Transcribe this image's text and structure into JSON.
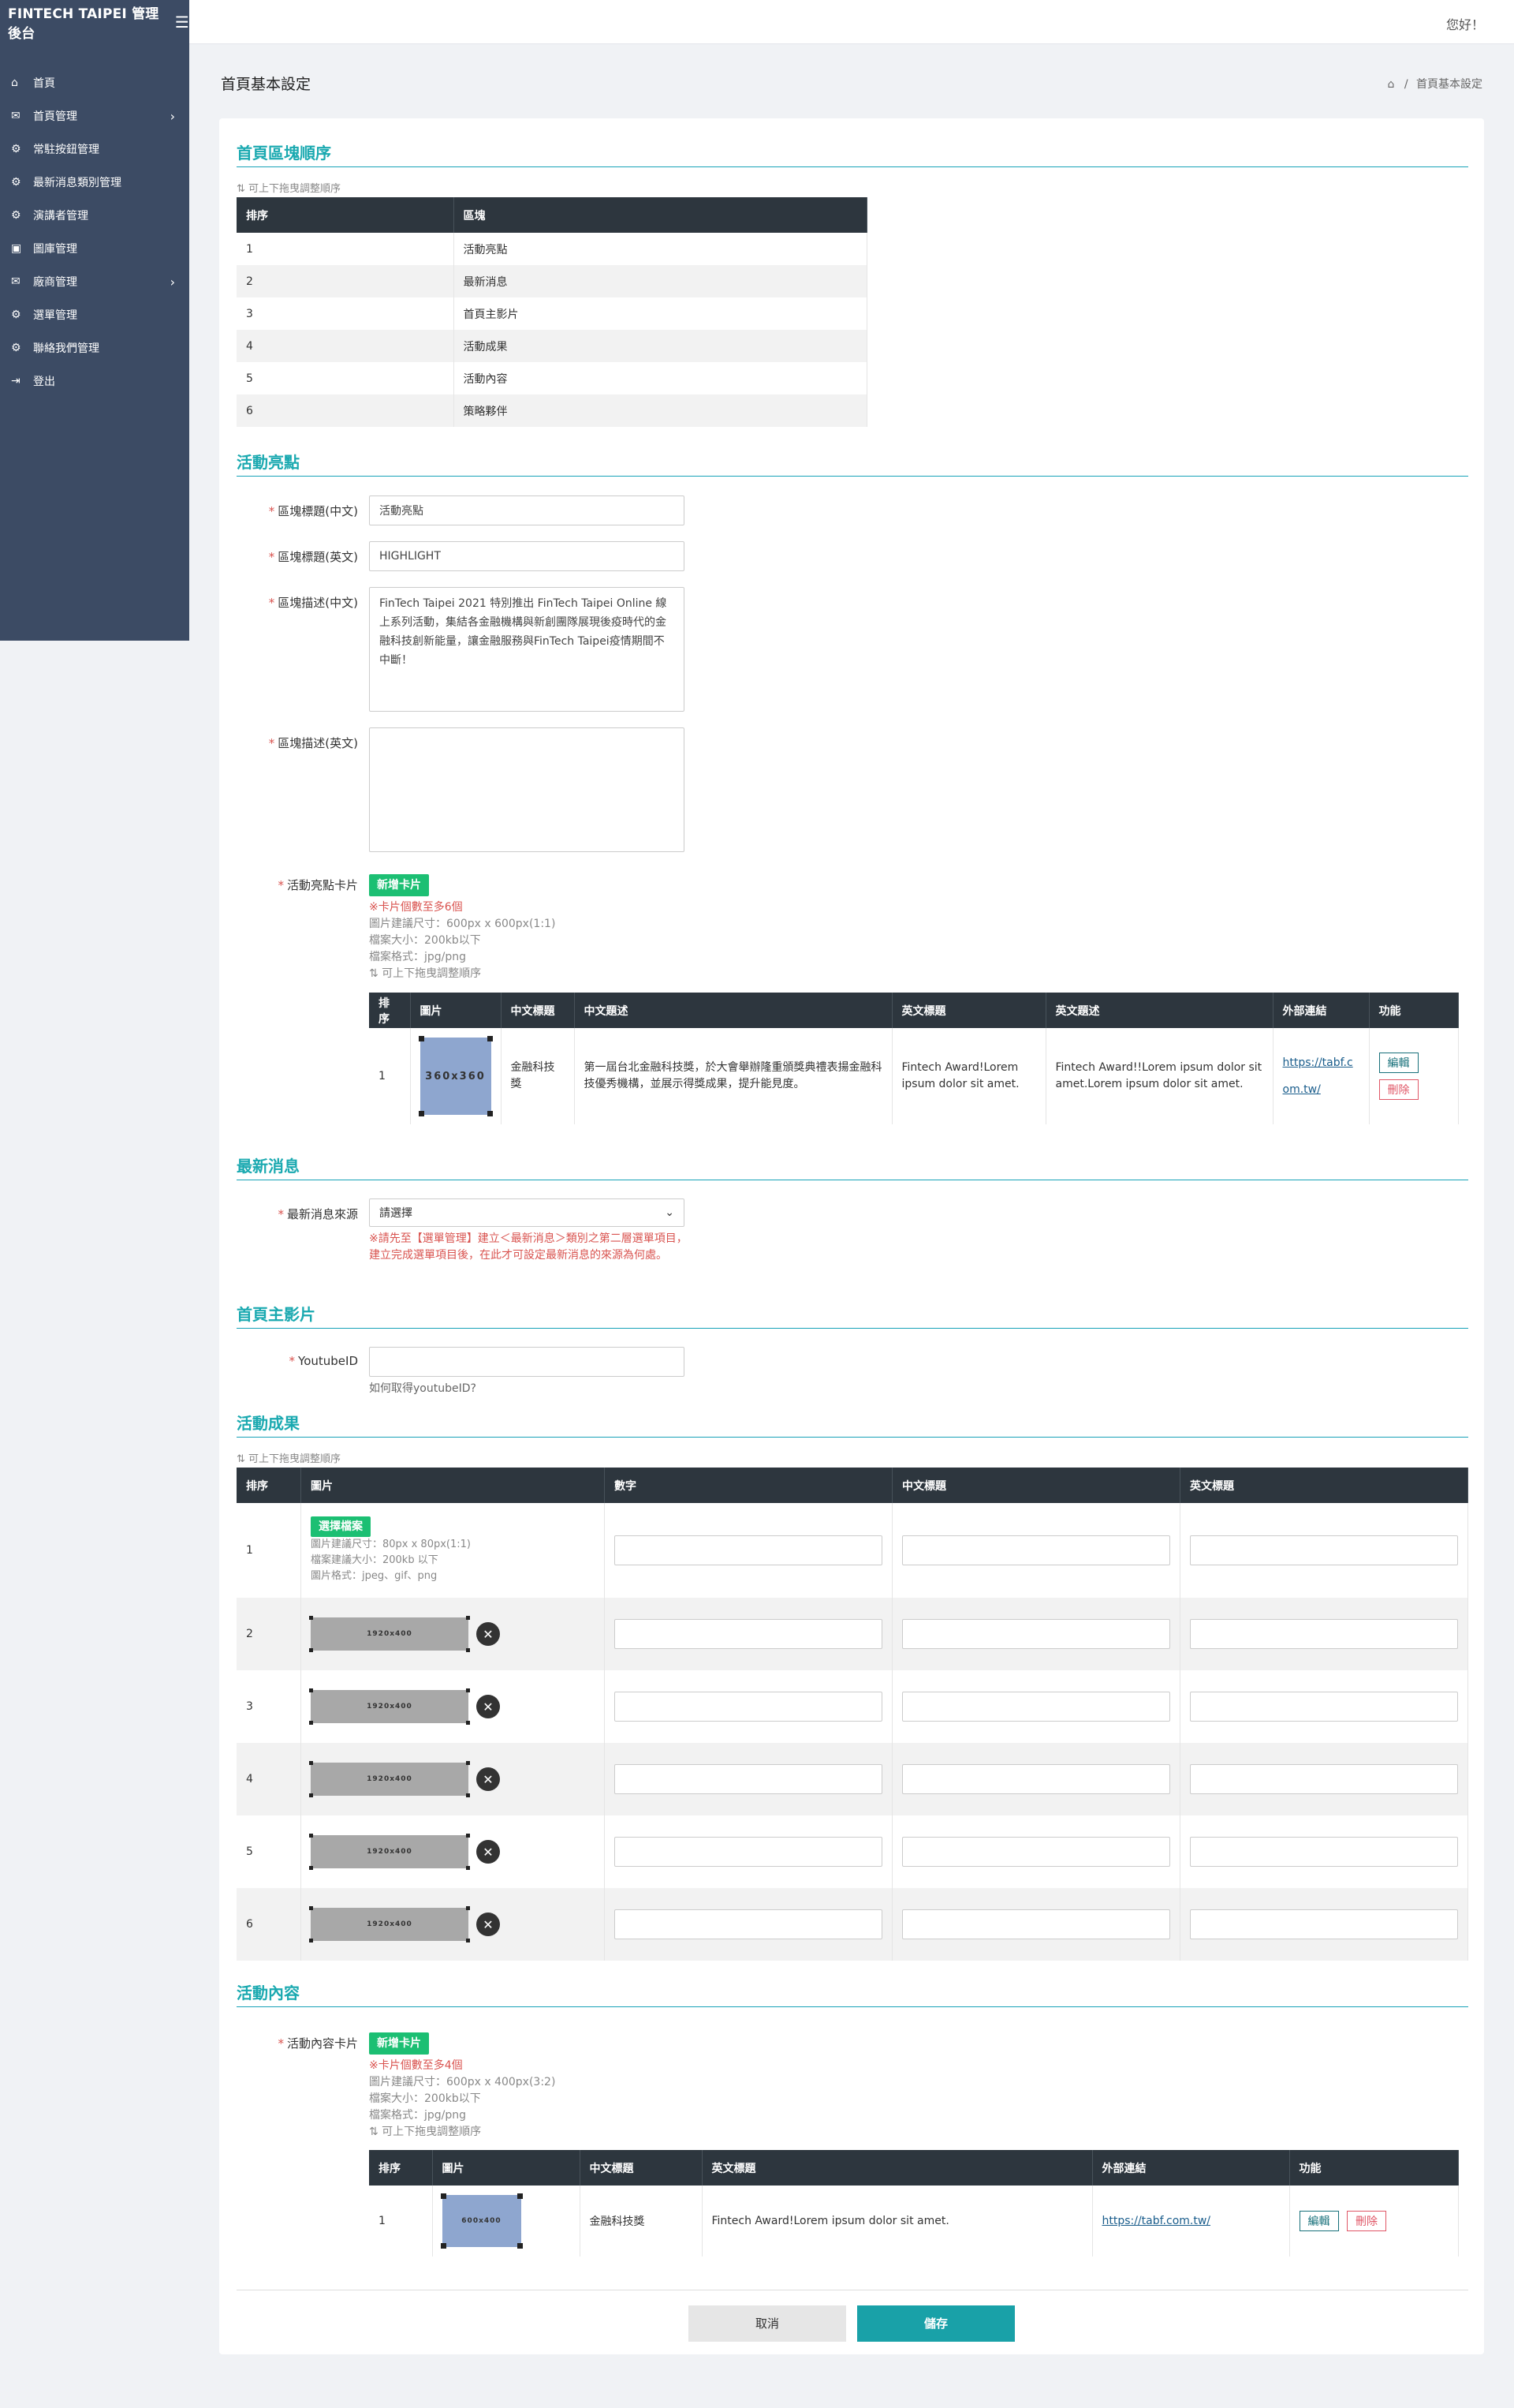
{
  "sidebar": {
    "brand": "FINTECH TAIPEI 管理後台",
    "hamburger_icon": "☰",
    "items": [
      {
        "label": "首頁",
        "icon": "⌂",
        "arrow": ""
      },
      {
        "label": "首頁管理",
        "icon": "✉",
        "arrow": "›"
      },
      {
        "label": "常駐按鈕管理",
        "icon": "⚙",
        "arrow": ""
      },
      {
        "label": "最新消息類別管理",
        "icon": "⚙",
        "arrow": ""
      },
      {
        "label": "演講者管理",
        "icon": "⚙",
        "arrow": ""
      },
      {
        "label": "圖庫管理",
        "icon": "▣",
        "arrow": ""
      },
      {
        "label": "廠商管理",
        "icon": "✉",
        "arrow": "›"
      },
      {
        "label": "選單管理",
        "icon": "⚙",
        "arrow": ""
      },
      {
        "label": "聯絡我們管理",
        "icon": "⚙",
        "arrow": ""
      },
      {
        "label": "登出",
        "icon": "⇥",
        "arrow": ""
      }
    ]
  },
  "topbar": {
    "greeting": "您好！"
  },
  "page": {
    "title": "首頁基本設定",
    "breadcrumb_home_icon": "⌂",
    "breadcrumb_sep": "/",
    "breadcrumb_current": "首頁基本設定"
  },
  "order_section": {
    "title": "首頁區塊順序",
    "hint": "⇅ 可上下拖曳調整順序",
    "headers": [
      "排序",
      "區塊"
    ],
    "rows": [
      [
        "1",
        "活動亮點"
      ],
      [
        "2",
        "最新消息"
      ],
      [
        "3",
        "首頁主影片"
      ],
      [
        "4",
        "活動成果"
      ],
      [
        "5",
        "活動內容"
      ],
      [
        "6",
        "策略夥伴"
      ]
    ]
  },
  "highlight": {
    "title": "活動亮點",
    "label_title_zh": "區塊標題(中文)",
    "value_title_zh": "活動亮點",
    "label_title_en": "區塊標題(英文)",
    "value_title_en": "HIGHLIGHT",
    "label_desc_zh": "區塊描述(中文)",
    "value_desc_zh": "FinTech Taipei 2021 特別推出 FinTech Taipei Online 線上系列活動，集結各金融機構與新創團隊展現後疫時代的金融科技創新能量，讓金融服務與FinTech Taipei疫情期間不中斷！",
    "label_desc_en": "區塊描述(英文)",
    "value_desc_en": "",
    "label_cards": "活動亮點卡片",
    "add_card": "新增卡片",
    "note_limit": "※卡片個數至多6個",
    "note_size": "圖片建議尺寸：600px x 600px(1:1)",
    "note_file": "檔案大小：200kb以下",
    "note_format": "檔案格式：jpg/png",
    "hint": "⇅ 可上下拖曳調整順序",
    "headers": [
      "排序",
      "圖片",
      "中文標題",
      "中文題述",
      "英文標題",
      "英文題述",
      "外部連結",
      "功能"
    ],
    "row": {
      "order": "1",
      "image_label": "360x360",
      "title_zh": "金融科技獎",
      "desc_zh": "第一屆台北金融科技獎，於大會舉辦隆重頒獎典禮表揚金融科技優秀機構，並展示得獎成果，提升能見度。",
      "title_en": "Fintech Award!Lorem ipsum dolor sit amet.",
      "desc_en": "Fintech Award!!Lorem ipsum dolor sit amet.Lorem ipsum dolor sit amet.",
      "link": "https://tabf.com.tw/",
      "edit": "編輯",
      "delete": "刪除"
    }
  },
  "news": {
    "title": "最新消息",
    "label_source": "最新消息來源",
    "select_value": "請選擇",
    "warning": "※請先至【選單管理】建立＜最新消息＞類別之第二層選單項目，建立完成選單項目後，在此才可設定最新消息的來源為何處。"
  },
  "video": {
    "title": "首頁主影片",
    "label_youtube": "YoutubeID",
    "value_youtube": "",
    "help": "如何取得youtubeID?"
  },
  "results": {
    "title": "活動成果",
    "hint": "⇅ 可上下拖曳調整順序",
    "headers": [
      "排序",
      "圖片",
      "數字",
      "中文標題",
      "英文標題"
    ],
    "choose_file": "選擇檔案",
    "note_size": "圖片建議尺寸：80px x 80px(1:1)",
    "note_file": "檔案建議大小：200kb 以下",
    "note_format": "圖片格式：jpeg、gif、png",
    "image_label": "1920x400",
    "remove_icon": "✕",
    "rows": [
      "1",
      "2",
      "3",
      "4",
      "5",
      "6"
    ]
  },
  "content": {
    "title": "活動內容",
    "label_cards": "活動內容卡片",
    "add_card": "新增卡片",
    "note_limit": "※卡片個數至多4個",
    "note_size": "圖片建議尺寸：600px x 400px(3:2)",
    "note_file": "檔案大小：200kb以下",
    "note_format": "檔案格式：jpg/png",
    "hint": "⇅ 可上下拖曳調整順序",
    "headers": [
      "排序",
      "圖片",
      "中文標題",
      "英文標題",
      "外部連結",
      "功能"
    ],
    "row": {
      "order": "1",
      "image_label": "600x400",
      "title_zh": "金融科技獎",
      "title_en": "Fintech Award!Lorem ipsum dolor sit amet.",
      "link": "https://tabf.com.tw/",
      "edit": "編輯",
      "delete": "刪除"
    }
  },
  "footer": {
    "cancel": "取消",
    "save": "儲存"
  },
  "colors": {
    "sidebar": "#3c4b64",
    "accent": "#1aa9b0",
    "green": "#1cbf73",
    "table_header": "#2d363e",
    "danger": "#d9534f"
  }
}
